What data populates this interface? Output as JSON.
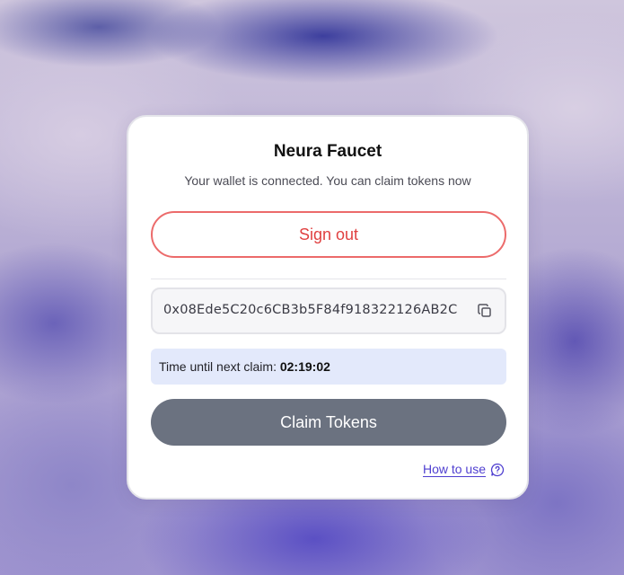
{
  "card": {
    "title": "Neura Faucet",
    "subtitle": "Your wallet is connected. You can claim tokens now",
    "sign_out_label": "Sign out",
    "wallet_address": "0x08Ede5C20c6CB3b5F84f918322126AB2C",
    "timer_label": "Time until next claim: ",
    "timer_value": "02:19:02",
    "claim_label": "Claim Tokens",
    "how_to_use_label": "How to use"
  },
  "icons": {
    "copy": "copy-icon",
    "help": "help-circle-icon"
  },
  "colors": {
    "sign_out": "#e04141",
    "claim_button": "#6b7280",
    "timer_bg": "#e3e9fb",
    "link": "#4f3fd0"
  }
}
